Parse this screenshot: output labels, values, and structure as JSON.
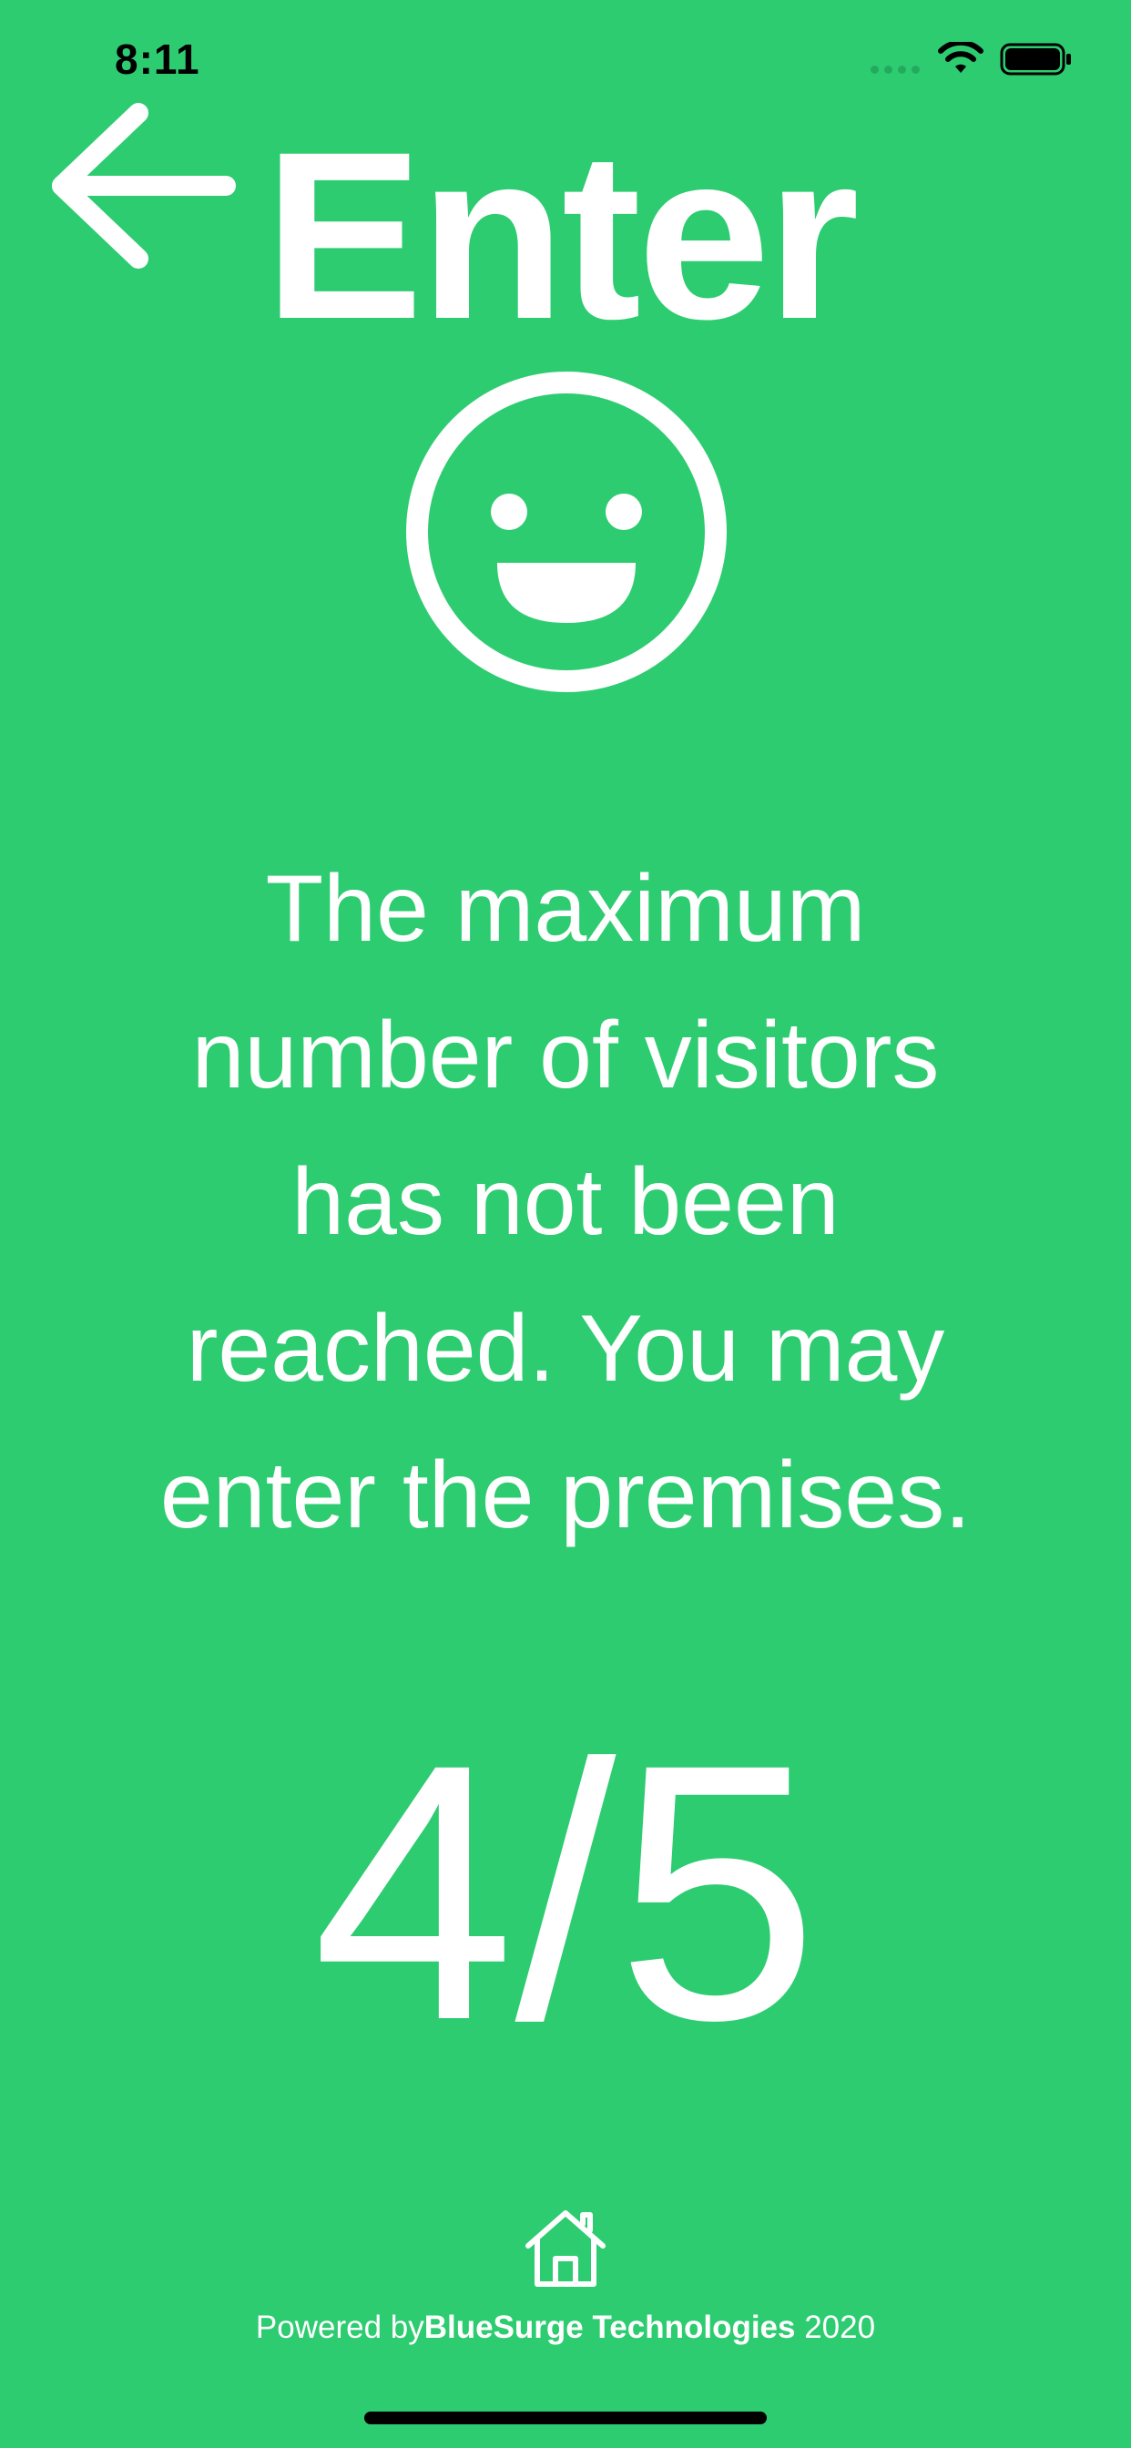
{
  "status_bar": {
    "time": "8:11",
    "icons": [
      "cellular-signal-icon",
      "wifi-icon",
      "battery-icon"
    ]
  },
  "header": {
    "back_icon": "arrow-left-icon",
    "title": "Enter"
  },
  "status_icon": "smiley-face-icon",
  "message": "The maximum number of visitors has not been reached. You may enter the premises.",
  "occupancy": {
    "text": "4/5",
    "current": 4,
    "max": 5
  },
  "footer": {
    "home_icon": "home-icon",
    "prefix": "Powered by",
    "brand": "BlueSurge Technologies",
    "year": " 2020"
  },
  "colors": {
    "background": "#2ECC71",
    "foreground": "#FFFFFF"
  }
}
